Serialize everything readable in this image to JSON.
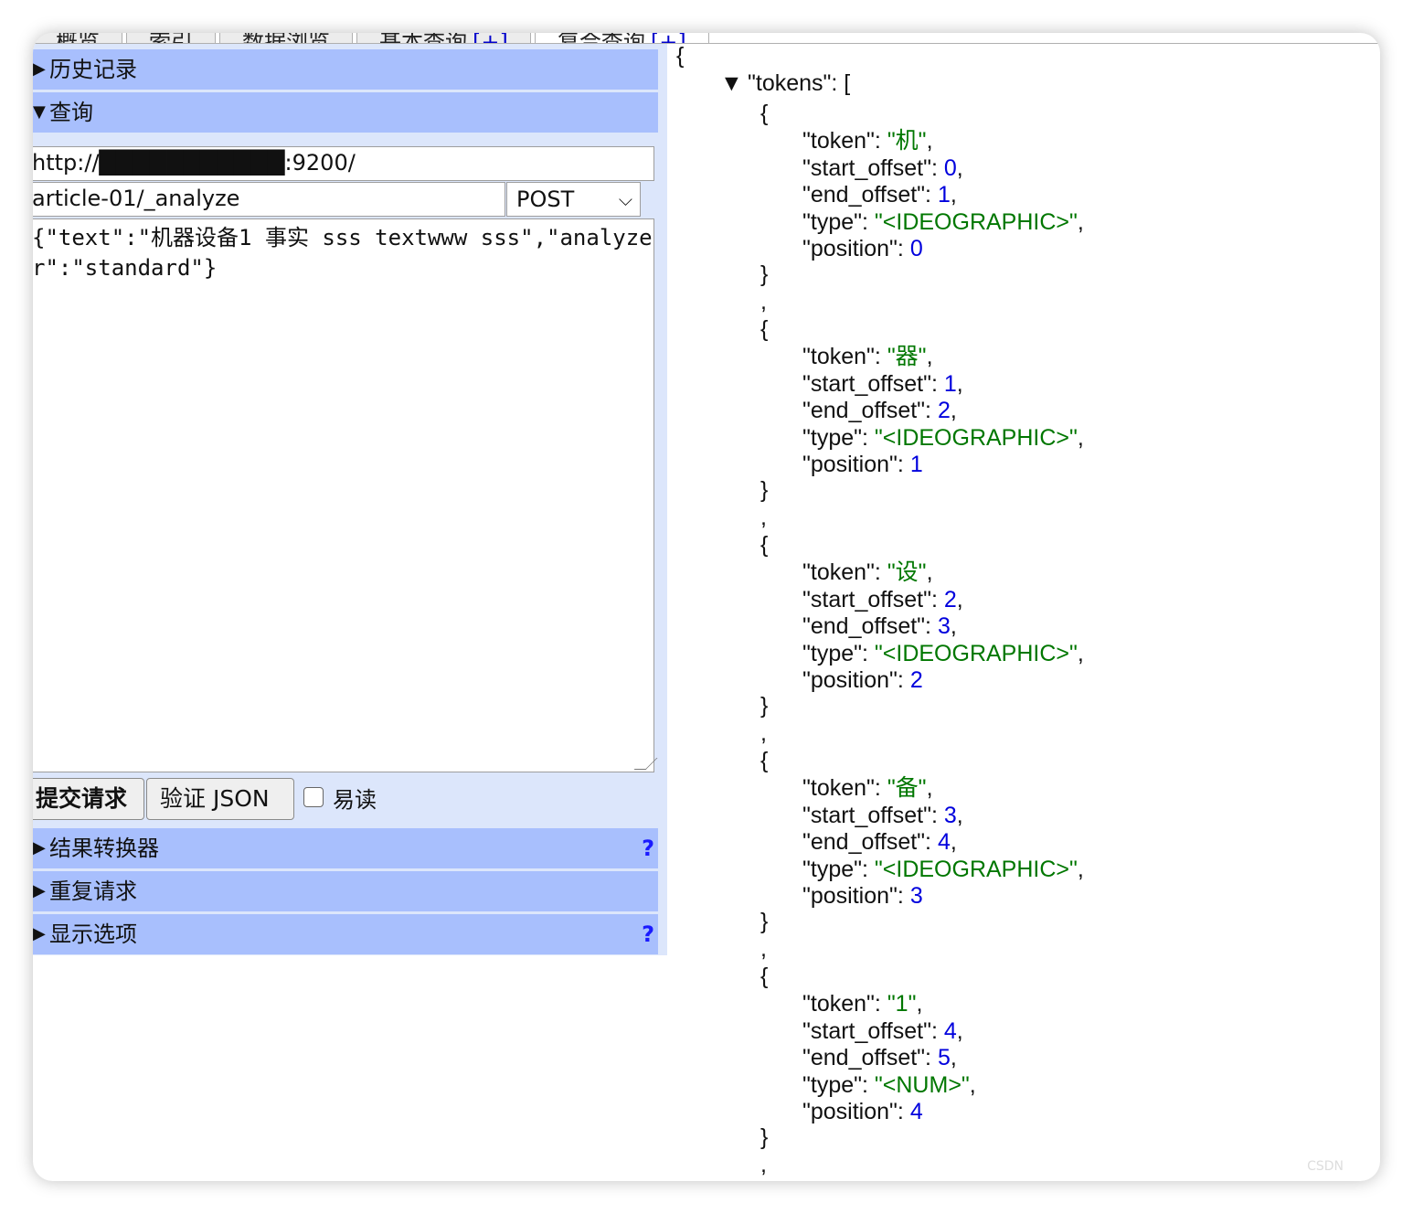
{
  "tabs": [
    {
      "label": "概览"
    },
    {
      "label": "索引"
    },
    {
      "label": "数据浏览"
    },
    {
      "label": "基本查询",
      "plus": "[+]"
    },
    {
      "label": "复合查询",
      "plus": "[+]"
    }
  ],
  "sections": {
    "history": "历史记录",
    "query": "查询",
    "transformer": "结果转换器",
    "repeat": "重复请求",
    "display": "显示选项",
    "help": "?"
  },
  "query": {
    "url": "http://███████████:9200/",
    "path": "article-01/_analyze",
    "method": "POST",
    "body": "{\"text\":\"机器设备1 事实 sss textwww sss\",\"analyzer\":\"standard\"}"
  },
  "buttons": {
    "submit": "提交请求",
    "validate": "验证 JSON",
    "pretty_label": "易读"
  },
  "result": {
    "open_brace": "{",
    "tokens_key": "\"tokens\": [",
    "tokens": [
      {
        "token": "\"机\"",
        "start_offset": "0",
        "end_offset": "1",
        "type": "\"<IDEOGRAPHIC>\"",
        "position": "0"
      },
      {
        "token": "\"器\"",
        "start_offset": "1",
        "end_offset": "2",
        "type": "\"<IDEOGRAPHIC>\"",
        "position": "1"
      },
      {
        "token": "\"设\"",
        "start_offset": "2",
        "end_offset": "3",
        "type": "\"<IDEOGRAPHIC>\"",
        "position": "2"
      },
      {
        "token": "\"备\"",
        "start_offset": "3",
        "end_offset": "4",
        "type": "\"<IDEOGRAPHIC>\"",
        "position": "3"
      },
      {
        "token": "\"1\"",
        "start_offset": "4",
        "end_offset": "5",
        "type": "\"<NUM>\"",
        "position": "4"
      }
    ]
  },
  "colors": {
    "section_bg": "#a8bffd",
    "panel_bg": "#dce6fb",
    "string": "#007700",
    "number": "#0000dd"
  }
}
